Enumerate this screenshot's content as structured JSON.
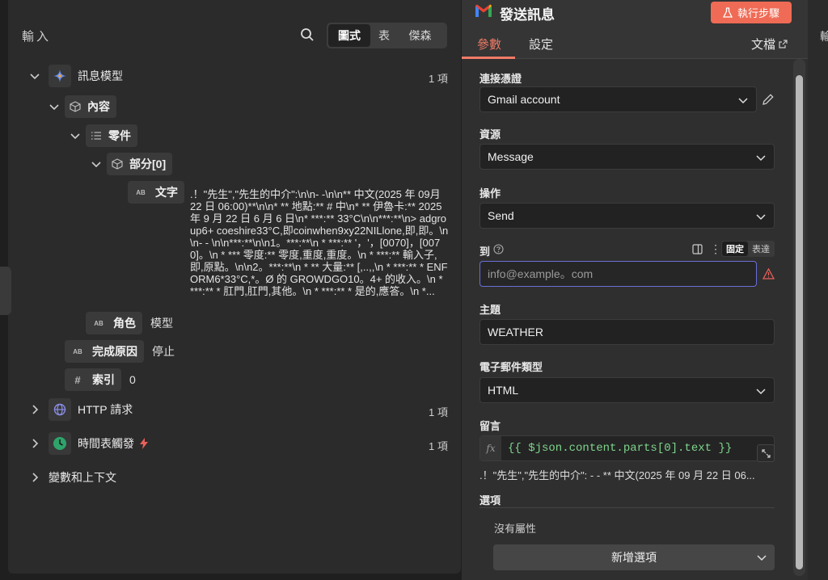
{
  "input_panel": {
    "title": "輸入",
    "view_modes": [
      "圖式",
      "表",
      "傑森"
    ],
    "active_view": "圖式",
    "tree": {
      "message_model": {
        "label": "訊息模型",
        "count": "1 項"
      },
      "content": {
        "label": "內容"
      },
      "parts": {
        "label": "零件"
      },
      "part0": {
        "label": "部分[0]"
      },
      "text": {
        "type_icon": "AB",
        "label": "文字",
        "value": ".！\"先生\",\"先生的中介\":\\n\\n- -\\n\\n** 中文(2025 年 09月 22 日 06:00)**\\n\\n* ** 地點:** # 中\\n* ** 伊魯卡:** 2025 年 9 月 22 日 6 月 6 日\\n* ***:** 33°C\\n\\n***:**\\n> adgroup6+ coeshire33°C,即coinwhen9xy22NILlone,即,即。\\n\\n- - \\n\\n***:**\\n\\n1。***:**\\n * ***:** '，'，[0070]，[0070]。\\n * *** 零度:** 零度,重度,重度。\\n * ***:** 輸入子,即,原點。\\n\\n2。***:**\\n * ** 大量:** [,..,,\\n * ***:** * ENFORM6*33°C,*。Ø 的 GROWDGO10。4+ 的收入。\\n * ***:** * 肛門,肛門,其他。\\n * ***:** * 是的,應答。\\n *..."
      },
      "role": {
        "type_icon": "AB",
        "label": "角色",
        "value": "模型"
      },
      "finish_reason": {
        "type_icon": "AB",
        "label": "完成原因",
        "value": "停止"
      },
      "index": {
        "type_icon": "#",
        "label": "索引",
        "value": "0"
      },
      "http": {
        "label": "HTTP 請求",
        "count": "1 項"
      },
      "schedule": {
        "label": "時間表觸發",
        "count": "1 項"
      },
      "variables": {
        "label": "變數和上下文"
      }
    }
  },
  "node_panel": {
    "title": "發送訊息",
    "execute_label": "執行步驟",
    "tabs": [
      "參數",
      "設定"
    ],
    "active_tab": "參數",
    "docs_label": "文檔",
    "fields": {
      "credential": {
        "label": "連接憑證",
        "value": "Gmail account"
      },
      "resource": {
        "label": "資源",
        "value": "Message"
      },
      "operation": {
        "label": "操作",
        "value": "Send"
      },
      "to": {
        "label": "到",
        "placeholder": "info@example。com",
        "mode_fixed": "固定",
        "mode_expr": "表達"
      },
      "subject": {
        "label": "主題",
        "value": "WEATHER"
      },
      "email_type": {
        "label": "電子郵件類型",
        "value": "HTML"
      },
      "message": {
        "label": "留言",
        "expression": "{{ $json.content.parts[0].text }}",
        "preview": ".！\"先生\",\"先生的中介\": - - ** 中文(2025 年 09 月 22 日 06..."
      },
      "options": {
        "label": "選項",
        "empty": "沒有屬性",
        "add_label": "新增選項"
      }
    }
  },
  "right_strip": {
    "label": "輸"
  },
  "colors": {
    "accent": "#f07a66",
    "button": "#ef6b55",
    "focus": "#6a6fd6",
    "warning": "#e8605a",
    "expression": "#7ed58d"
  }
}
